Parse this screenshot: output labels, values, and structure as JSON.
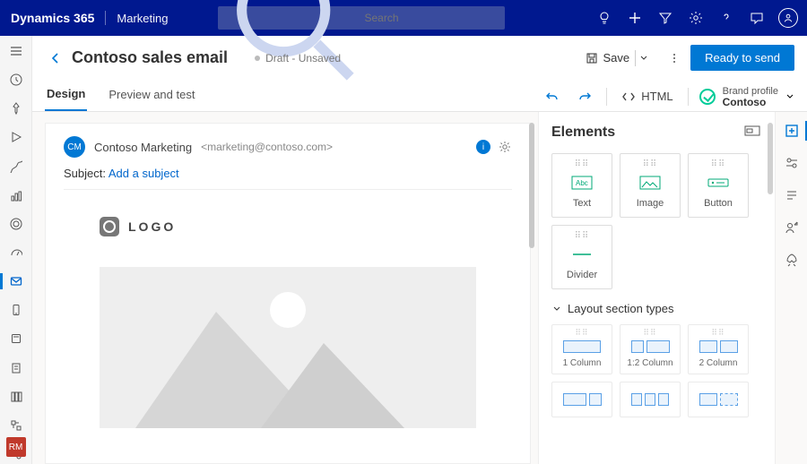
{
  "topbar": {
    "brand": "Dynamics 365",
    "area": "Marketing",
    "search_placeholder": "Search"
  },
  "header": {
    "title": "Contoso sales email",
    "status": "Draft - Unsaved",
    "save": "Save",
    "primary": "Ready to send"
  },
  "tabs": {
    "design": "Design",
    "preview": "Preview and test",
    "html": "HTML",
    "brandprofile_label": "Brand profile",
    "brandprofile_value": "Contoso"
  },
  "canvas": {
    "from_initials": "CM",
    "from_name": "Contoso Marketing",
    "from_email": "<marketing@contoso.com>",
    "subject_label": "Subject:",
    "subject_link": "Add a subject",
    "logo_text": "LOGO"
  },
  "panel": {
    "title": "Elements",
    "cards": {
      "text": "Text",
      "image": "Image",
      "button": "Button",
      "divider": "Divider"
    },
    "layout_title": "Layout section types",
    "layouts": {
      "c1": "1 Column",
      "c12": "1:2 Column",
      "c2": "2 Column"
    }
  },
  "rail_avatar": "RM"
}
